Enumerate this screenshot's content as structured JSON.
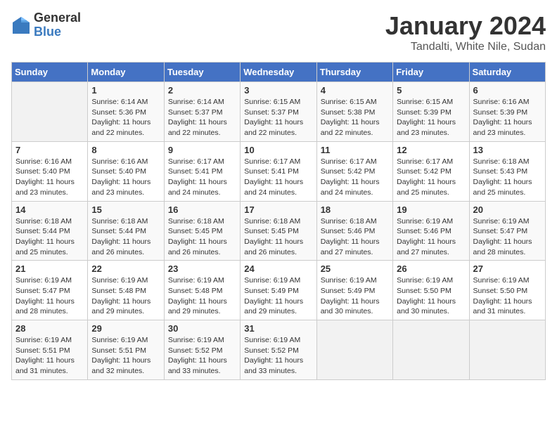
{
  "logo": {
    "text_general": "General",
    "text_blue": "Blue"
  },
  "header": {
    "month_year": "January 2024",
    "location": "Tandalti, White Nile, Sudan"
  },
  "weekdays": [
    "Sunday",
    "Monday",
    "Tuesday",
    "Wednesday",
    "Thursday",
    "Friday",
    "Saturday"
  ],
  "weeks": [
    [
      {
        "day": "",
        "sunrise": "",
        "sunset": "",
        "daylight": ""
      },
      {
        "day": "1",
        "sunrise": "Sunrise: 6:14 AM",
        "sunset": "Sunset: 5:36 PM",
        "daylight": "Daylight: 11 hours and 22 minutes."
      },
      {
        "day": "2",
        "sunrise": "Sunrise: 6:14 AM",
        "sunset": "Sunset: 5:37 PM",
        "daylight": "Daylight: 11 hours and 22 minutes."
      },
      {
        "day": "3",
        "sunrise": "Sunrise: 6:15 AM",
        "sunset": "Sunset: 5:37 PM",
        "daylight": "Daylight: 11 hours and 22 minutes."
      },
      {
        "day": "4",
        "sunrise": "Sunrise: 6:15 AM",
        "sunset": "Sunset: 5:38 PM",
        "daylight": "Daylight: 11 hours and 22 minutes."
      },
      {
        "day": "5",
        "sunrise": "Sunrise: 6:15 AM",
        "sunset": "Sunset: 5:39 PM",
        "daylight": "Daylight: 11 hours and 23 minutes."
      },
      {
        "day": "6",
        "sunrise": "Sunrise: 6:16 AM",
        "sunset": "Sunset: 5:39 PM",
        "daylight": "Daylight: 11 hours and 23 minutes."
      }
    ],
    [
      {
        "day": "7",
        "sunrise": "Sunrise: 6:16 AM",
        "sunset": "Sunset: 5:40 PM",
        "daylight": "Daylight: 11 hours and 23 minutes."
      },
      {
        "day": "8",
        "sunrise": "Sunrise: 6:16 AM",
        "sunset": "Sunset: 5:40 PM",
        "daylight": "Daylight: 11 hours and 23 minutes."
      },
      {
        "day": "9",
        "sunrise": "Sunrise: 6:17 AM",
        "sunset": "Sunset: 5:41 PM",
        "daylight": "Daylight: 11 hours and 24 minutes."
      },
      {
        "day": "10",
        "sunrise": "Sunrise: 6:17 AM",
        "sunset": "Sunset: 5:41 PM",
        "daylight": "Daylight: 11 hours and 24 minutes."
      },
      {
        "day": "11",
        "sunrise": "Sunrise: 6:17 AM",
        "sunset": "Sunset: 5:42 PM",
        "daylight": "Daylight: 11 hours and 24 minutes."
      },
      {
        "day": "12",
        "sunrise": "Sunrise: 6:17 AM",
        "sunset": "Sunset: 5:42 PM",
        "daylight": "Daylight: 11 hours and 25 minutes."
      },
      {
        "day": "13",
        "sunrise": "Sunrise: 6:18 AM",
        "sunset": "Sunset: 5:43 PM",
        "daylight": "Daylight: 11 hours and 25 minutes."
      }
    ],
    [
      {
        "day": "14",
        "sunrise": "Sunrise: 6:18 AM",
        "sunset": "Sunset: 5:44 PM",
        "daylight": "Daylight: 11 hours and 25 minutes."
      },
      {
        "day": "15",
        "sunrise": "Sunrise: 6:18 AM",
        "sunset": "Sunset: 5:44 PM",
        "daylight": "Daylight: 11 hours and 26 minutes."
      },
      {
        "day": "16",
        "sunrise": "Sunrise: 6:18 AM",
        "sunset": "Sunset: 5:45 PM",
        "daylight": "Daylight: 11 hours and 26 minutes."
      },
      {
        "day": "17",
        "sunrise": "Sunrise: 6:18 AM",
        "sunset": "Sunset: 5:45 PM",
        "daylight": "Daylight: 11 hours and 26 minutes."
      },
      {
        "day": "18",
        "sunrise": "Sunrise: 6:18 AM",
        "sunset": "Sunset: 5:46 PM",
        "daylight": "Daylight: 11 hours and 27 minutes."
      },
      {
        "day": "19",
        "sunrise": "Sunrise: 6:19 AM",
        "sunset": "Sunset: 5:46 PM",
        "daylight": "Daylight: 11 hours and 27 minutes."
      },
      {
        "day": "20",
        "sunrise": "Sunrise: 6:19 AM",
        "sunset": "Sunset: 5:47 PM",
        "daylight": "Daylight: 11 hours and 28 minutes."
      }
    ],
    [
      {
        "day": "21",
        "sunrise": "Sunrise: 6:19 AM",
        "sunset": "Sunset: 5:47 PM",
        "daylight": "Daylight: 11 hours and 28 minutes."
      },
      {
        "day": "22",
        "sunrise": "Sunrise: 6:19 AM",
        "sunset": "Sunset: 5:48 PM",
        "daylight": "Daylight: 11 hours and 29 minutes."
      },
      {
        "day": "23",
        "sunrise": "Sunrise: 6:19 AM",
        "sunset": "Sunset: 5:48 PM",
        "daylight": "Daylight: 11 hours and 29 minutes."
      },
      {
        "day": "24",
        "sunrise": "Sunrise: 6:19 AM",
        "sunset": "Sunset: 5:49 PM",
        "daylight": "Daylight: 11 hours and 29 minutes."
      },
      {
        "day": "25",
        "sunrise": "Sunrise: 6:19 AM",
        "sunset": "Sunset: 5:49 PM",
        "daylight": "Daylight: 11 hours and 30 minutes."
      },
      {
        "day": "26",
        "sunrise": "Sunrise: 6:19 AM",
        "sunset": "Sunset: 5:50 PM",
        "daylight": "Daylight: 11 hours and 30 minutes."
      },
      {
        "day": "27",
        "sunrise": "Sunrise: 6:19 AM",
        "sunset": "Sunset: 5:50 PM",
        "daylight": "Daylight: 11 hours and 31 minutes."
      }
    ],
    [
      {
        "day": "28",
        "sunrise": "Sunrise: 6:19 AM",
        "sunset": "Sunset: 5:51 PM",
        "daylight": "Daylight: 11 hours and 31 minutes."
      },
      {
        "day": "29",
        "sunrise": "Sunrise: 6:19 AM",
        "sunset": "Sunset: 5:51 PM",
        "daylight": "Daylight: 11 hours and 32 minutes."
      },
      {
        "day": "30",
        "sunrise": "Sunrise: 6:19 AM",
        "sunset": "Sunset: 5:52 PM",
        "daylight": "Daylight: 11 hours and 33 minutes."
      },
      {
        "day": "31",
        "sunrise": "Sunrise: 6:19 AM",
        "sunset": "Sunset: 5:52 PM",
        "daylight": "Daylight: 11 hours and 33 minutes."
      },
      {
        "day": "",
        "sunrise": "",
        "sunset": "",
        "daylight": ""
      },
      {
        "day": "",
        "sunrise": "",
        "sunset": "",
        "daylight": ""
      },
      {
        "day": "",
        "sunrise": "",
        "sunset": "",
        "daylight": ""
      }
    ]
  ]
}
